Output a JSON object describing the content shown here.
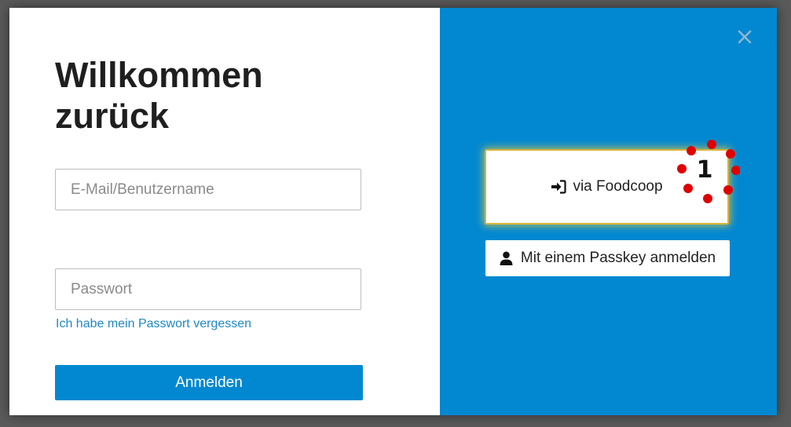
{
  "login": {
    "title": "Willkommen zurück",
    "email_placeholder": "E-Mail/Benutzername",
    "password_placeholder": "Passwort",
    "forgot_link": "Ich habe mein Passwort vergessen",
    "submit_label": "Anmelden"
  },
  "sso": {
    "foodcoop_label": "via Foodcoop",
    "passkey_label": "Mit einem Passkey anmelden"
  },
  "annotation": {
    "marker_number": "1"
  },
  "icons": {
    "close": "close-icon",
    "login": "sign-in-icon",
    "user": "user-icon"
  },
  "colors": {
    "accent": "#0288d1",
    "link": "#1f88c6",
    "highlight": "#d8b53a",
    "marker": "#e00000"
  }
}
